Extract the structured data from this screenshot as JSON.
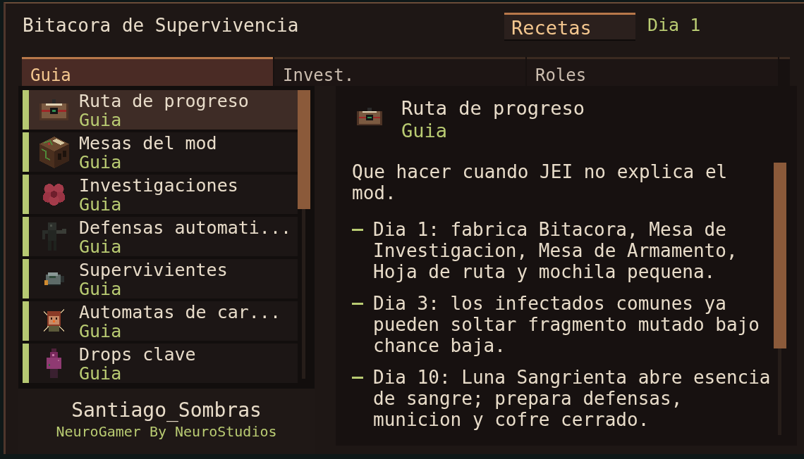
{
  "window": {
    "title": "Bitacora de Supervivencia"
  },
  "header": {
    "button": "Recetas",
    "day": "Dia 1"
  },
  "tabs": [
    {
      "label": "Guia",
      "selected": true
    },
    {
      "label": "Invest.",
      "selected": false
    },
    {
      "label": "Roles",
      "selected": false
    }
  ],
  "sidebar": {
    "items": [
      {
        "title": "Ruta de progreso",
        "subtitle": "Guia",
        "selected": true
      },
      {
        "title": "Mesas del mod",
        "subtitle": "Guia",
        "selected": false
      },
      {
        "title": "Investigaciones",
        "subtitle": "Guia",
        "selected": false
      },
      {
        "title": "Defensas automati...",
        "subtitle": "Guia",
        "selected": false
      },
      {
        "title": "Supervivientes",
        "subtitle": "Guia",
        "selected": false
      },
      {
        "title": "Automatas de car...",
        "subtitle": "Guia",
        "selected": false
      },
      {
        "title": "Drops clave",
        "subtitle": "Guia",
        "selected": false
      }
    ]
  },
  "footer": {
    "player_name": "Santiago_Sombras",
    "credit": "NeuroGamer By NeuroStudios"
  },
  "detail": {
    "title": "Ruta de progreso",
    "subtitle": "Guia",
    "intro": "Que hacer cuando JEI no explica el mod.",
    "bullets": [
      "Dia 1: fabrica Bitacora, Mesa de Investigacion, Mesa de Armamento, Hoja de ruta y mochila pequena.",
      "Dia 3: los infectados comunes ya pueden soltar fragmento mutado bajo chance baja.",
      "Dia 10: Luna Sangrienta abre esencia de sangre; prepara defensas, municion y cofre cerrado."
    ]
  }
}
